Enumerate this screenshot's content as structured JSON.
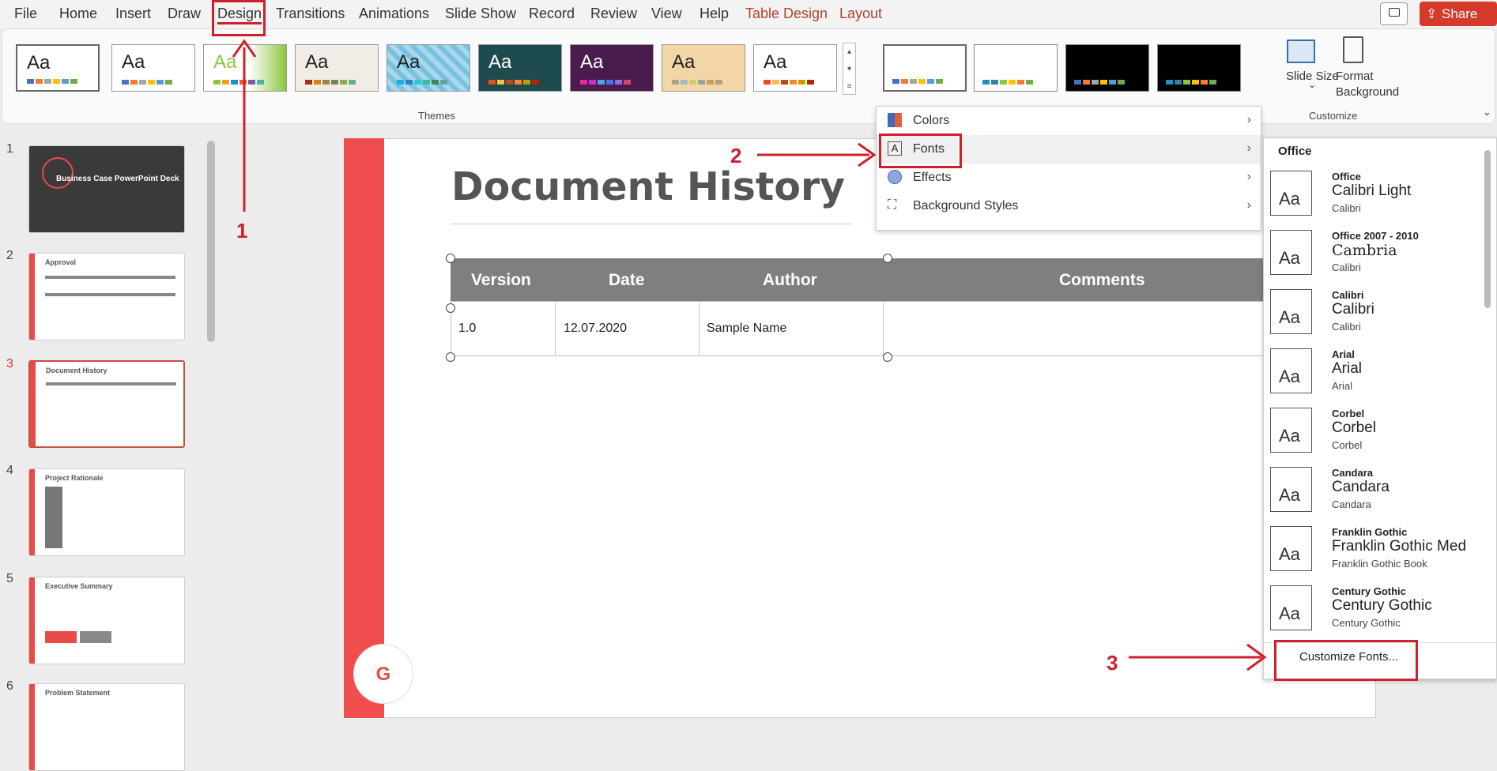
{
  "tabs": {
    "file": "File",
    "home": "Home",
    "insert": "Insert",
    "draw": "Draw",
    "design": "Design",
    "transitions": "Transitions",
    "animations": "Animations",
    "slideshow": "Slide Show",
    "record": "Record",
    "review": "Review",
    "view": "View",
    "help": "Help",
    "table_design": "Table Design",
    "layout": "Layout"
  },
  "share": {
    "label": "Share"
  },
  "themes": {
    "label": "Themes",
    "items": [
      "Aa",
      "Aa",
      "Aa",
      "Aa",
      "Aa",
      "Aa",
      "Aa",
      "Aa",
      "Aa"
    ]
  },
  "customize": {
    "label": "Customize",
    "slide_size": "Slide Size",
    "slide_size_chevron": "⌄",
    "format_bg_1": "Format",
    "format_bg_2": "Background"
  },
  "thumbs": [
    {
      "num": "1",
      "title": "Business Case PowerPoint Deck"
    },
    {
      "num": "2",
      "title": "Approval"
    },
    {
      "num": "3",
      "title": "Document History"
    },
    {
      "num": "4",
      "title": "Project Rationale"
    },
    {
      "num": "5",
      "title": "Executive Summary"
    },
    {
      "num": "6",
      "title": "Problem Statement"
    }
  ],
  "slide": {
    "title": "Document History",
    "headers": [
      "Version",
      "Date",
      "Author",
      "Comments"
    ],
    "row": [
      "1.0",
      "12.07.2020",
      "Sample Name",
      ""
    ],
    "logo": "G"
  },
  "design_menu": {
    "colors": "Colors",
    "fonts": "Fonts",
    "effects": "Effects",
    "bg_styles": "Background Styles"
  },
  "fonts_panel": {
    "heading": "Office",
    "items": [
      {
        "n1": "Office",
        "n2": "Calibri Light",
        "n3": "Calibri"
      },
      {
        "n1": "Office 2007 - 2010",
        "n2": "Cambria",
        "n3": "Calibri"
      },
      {
        "n1": "Calibri",
        "n2": "Calibri",
        "n3": "Calibri"
      },
      {
        "n1": "Arial",
        "n2": "Arial",
        "n3": "Arial"
      },
      {
        "n1": "Corbel",
        "n2": "Corbel",
        "n3": "Corbel"
      },
      {
        "n1": "Candara",
        "n2": "Candara",
        "n3": "Candara"
      },
      {
        "n1": "Franklin Gothic",
        "n2": "Franklin Gothic Med",
        "n3": "Franklin Gothic Book"
      },
      {
        "n1": "Century Gothic",
        "n2": "Century Gothic",
        "n3": "Century Gothic"
      }
    ],
    "preview": "Aa",
    "customize": "Customize Fonts..."
  },
  "callouts": {
    "one": "1",
    "two": "2",
    "three": "3"
  }
}
